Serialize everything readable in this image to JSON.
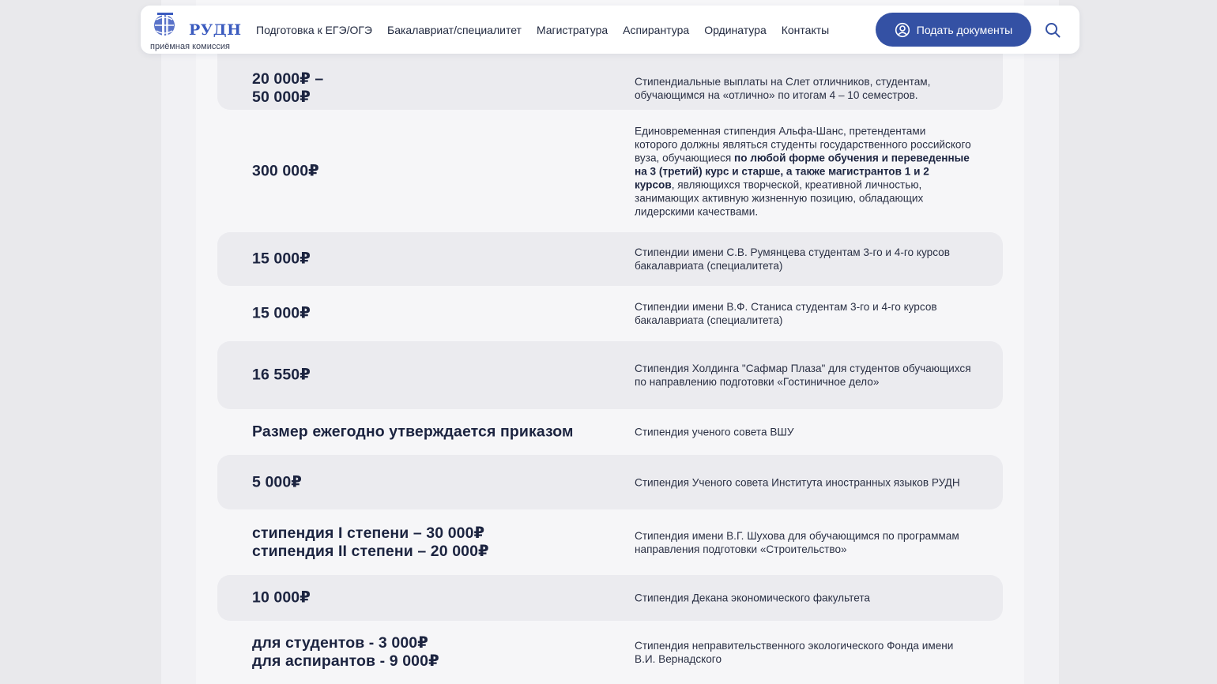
{
  "header": {
    "logo": {
      "title": "РУДН",
      "subtitle": "приёмная комиссия"
    },
    "nav": [
      {
        "label": "Подготовка к ЕГЭ/ОГЭ"
      },
      {
        "label": "Бакалавриат/специалитет"
      },
      {
        "label": "Магистратура"
      },
      {
        "label": "Аспирантура"
      },
      {
        "label": "Ординатура"
      },
      {
        "label": "Контакты"
      }
    ],
    "cta_label": "Подать документы",
    "colors": {
      "accent": "#3451a4",
      "logo": "#3b5bbf"
    }
  },
  "scholarships": [
    {
      "amount": "20 000₽ –\n50 000₽",
      "desc": [
        {
          "text": "Стипендиальные выплаты на Слет отличников, студентам, обучающимся на «отлично» по итогам 4 – 10 семестров."
        }
      ]
    },
    {
      "amount": "300 000₽",
      "desc": [
        {
          "text": "Единовременная стипендия Альфа-Шанс, претендентами которого должны являться студенты государственного российского вуза, обучающиеся "
        },
        {
          "text": "по любой форме обучения и переведенные на 3 (третий) курс и старше, а также магистрантов 1 и 2 курсов",
          "bold": true
        },
        {
          "text": ", являющихся творческой, креативной личностью, занимающих активную жизненную позицию, обладающих лидерскими качествами."
        }
      ]
    },
    {
      "amount": "15 000₽",
      "desc": [
        {
          "text": "Стипендии имени С.В. Румянцева студентам 3-го и 4-го курсов бакалавриата (специалитета)"
        }
      ]
    },
    {
      "amount": "15 000₽",
      "desc": [
        {
          "text": "Стипендии имени В.Ф. Станиса студентам 3-го и 4-го курсов бакалавриата (специалитета)"
        }
      ]
    },
    {
      "amount": "16 550₽",
      "desc": [
        {
          "text": "Стипендия Холдинга \"Сафмар Плаза\" для студентов обучающихся по направлению подготовки «Гостиничное дело»"
        }
      ]
    },
    {
      "amount": "Размер ежегодно утверждается приказом",
      "desc": [
        {
          "text": "Стипендия ученого совета ВШУ"
        }
      ]
    },
    {
      "amount": "5 000₽",
      "desc": [
        {
          "text": "Стипендия Ученого совета Института иностранных языков РУДН"
        }
      ]
    },
    {
      "amount": "стипендия I степени – 30 000₽\nстипендия II степени – 20 000₽",
      "desc": [
        {
          "text": "Стипендия имени В.Г. Шухова для обучающимся по программам направления подготовки «Строительство»"
        }
      ]
    },
    {
      "amount": "10 000₽",
      "desc": [
        {
          "text": "Стипендия Декана экономического факультета"
        }
      ]
    },
    {
      "amount": "для студентов - 3 000₽\nдля аспирантов - 9 000₽",
      "desc": [
        {
          "text": "Стипендия неправительственного экологического Фонда имени В.И. Вернадского"
        }
      ]
    }
  ]
}
